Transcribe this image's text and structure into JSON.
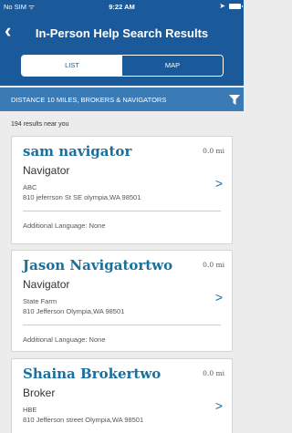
{
  "status_bar": {
    "carrier": "No SIM ᯤ",
    "time": "9:22 AM",
    "location_icon": "location-arrow-icon"
  },
  "header": {
    "back_icon": "chevron-left-icon",
    "title": "In-Person Help Search Results"
  },
  "tabs": [
    {
      "label": "LIST",
      "selected": true
    },
    {
      "label": "MAP",
      "selected": false
    }
  ],
  "filter": {
    "label": "DISTANCE  10 MILES, BROKERS & NAVIGATORS",
    "icon": "filter-icon"
  },
  "results_count": "194 results near you",
  "results": [
    {
      "name": "sam navigator",
      "distance": "0.0 mi",
      "role": "Navigator",
      "company": "ABC",
      "address": "810 jeferrson St SE olympia,WA 98501",
      "language": "Additional Language: None"
    },
    {
      "name": "Jason Navigatortwo",
      "distance": "0.0 mi",
      "role": "Navigator",
      "company": "State Farm",
      "address": "810 Jefferson Olympia,WA 98501",
      "language": "Additional Language: None"
    },
    {
      "name": "Shaina Brokertwo",
      "distance": "0.0 mi",
      "role": "Broker",
      "company": "HBE",
      "address": "810 Jefferson street Olympia,WA 98501",
      "language": ""
    }
  ],
  "colors": {
    "header_bg": "#1a5a9a",
    "filter_bg": "#3a7ab5",
    "name_color": "#1a6f9d",
    "page_bg": "#ececec"
  }
}
